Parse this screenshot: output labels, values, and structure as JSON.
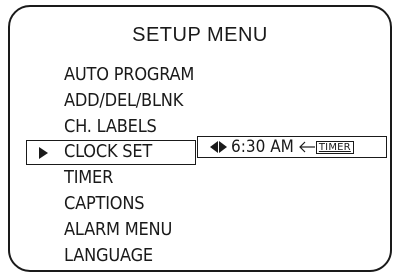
{
  "screen": {
    "title": "SETUP MENU"
  },
  "menu": {
    "items": [
      {
        "label": "AUTO PROGRAM"
      },
      {
        "label": "ADD/DEL/BLNK"
      },
      {
        "label": "CH. LABELS"
      },
      {
        "label": "CLOCK SET",
        "selected": true
      },
      {
        "label": "TIMER"
      },
      {
        "label": "CAPTIONS"
      },
      {
        "label": "ALARM MENU"
      },
      {
        "label": "LANGUAGE"
      }
    ],
    "pointer_icon": "right-triangle-pointer"
  },
  "clock_set_option": {
    "adjust_icon": "left-right-triangles",
    "value": "6:30 AM",
    "return_icon": "left-arrow",
    "return_key_label": "TIMER"
  }
}
